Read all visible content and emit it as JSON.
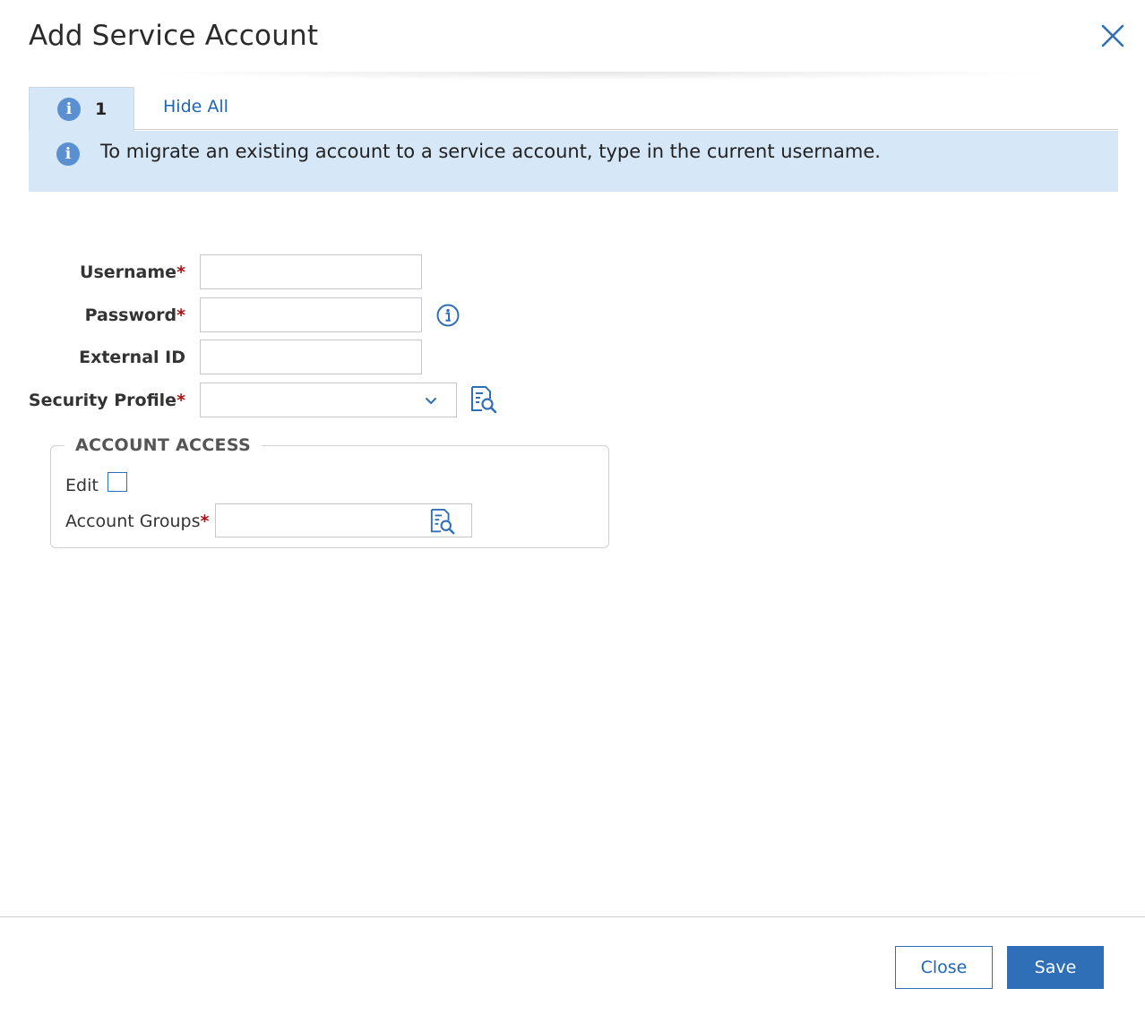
{
  "dialog": {
    "title": "Add Service Account",
    "close_icon": "close-icon"
  },
  "tabs": {
    "info_count": "1",
    "info_icon": "info-icon",
    "hide_all_label": "Hide All"
  },
  "banner": {
    "icon": "info-icon",
    "message": "To migrate an existing account to a service account, type in the current username."
  },
  "form": {
    "username": {
      "label": "Username",
      "required_mark": "*",
      "value": ""
    },
    "password": {
      "label": "Password",
      "required_mark": "*",
      "value": "",
      "help_icon": "info-circle-icon"
    },
    "external_id": {
      "label": "External ID",
      "value": ""
    },
    "security_profile": {
      "label": "Security Profile",
      "required_mark": "*",
      "selected": "",
      "browse_icon": "lookup-icon"
    }
  },
  "account_access": {
    "legend": "ACCOUNT ACCESS",
    "edit_label": "Edit",
    "edit_checked": false,
    "account_groups": {
      "label": "Account Groups",
      "required_mark": "*",
      "value": "",
      "browse_icon": "lookup-icon"
    }
  },
  "footer": {
    "close_label": "Close",
    "save_label": "Save"
  },
  "colors": {
    "accent": "#2f6fb7",
    "link": "#1d66b8",
    "banner_bg": "#d6e7f8",
    "required": "#a31515"
  }
}
